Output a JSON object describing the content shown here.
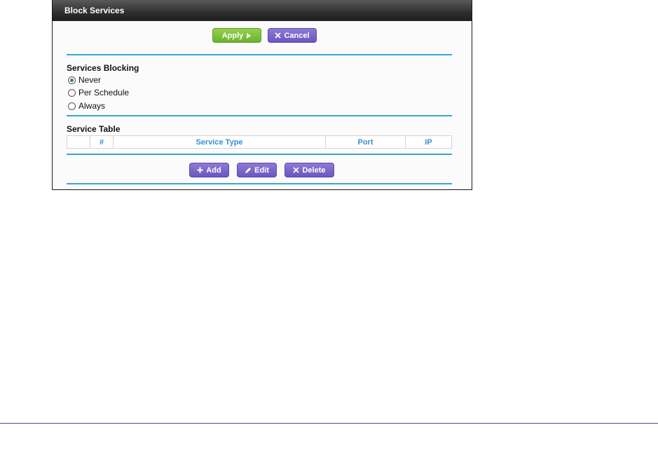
{
  "window": {
    "title": "Block Services"
  },
  "toolbar": {
    "apply_label": "Apply",
    "cancel_label": "Cancel"
  },
  "services_blocking": {
    "heading": "Services Blocking",
    "options": [
      {
        "label": "Never",
        "selected": true
      },
      {
        "label": "Per Schedule",
        "selected": false
      },
      {
        "label": "Always",
        "selected": false
      }
    ]
  },
  "service_table": {
    "heading": "Service Table",
    "columns": [
      "",
      "#",
      "Service Type",
      "Port",
      "IP"
    ]
  },
  "table_actions": {
    "add_label": "Add",
    "edit_label": "Edit",
    "delete_label": "Delete"
  },
  "colors": {
    "accent_rule": "#3aa6d0",
    "apply_green": "#7cc03a",
    "purple_button": "#7a66cc",
    "footer_line": "#5b3f99"
  },
  "icons": {
    "apply": "play-arrow-icon",
    "cancel": "x-icon",
    "add": "plus-icon",
    "edit": "pencil-icon",
    "delete": "x-icon"
  }
}
